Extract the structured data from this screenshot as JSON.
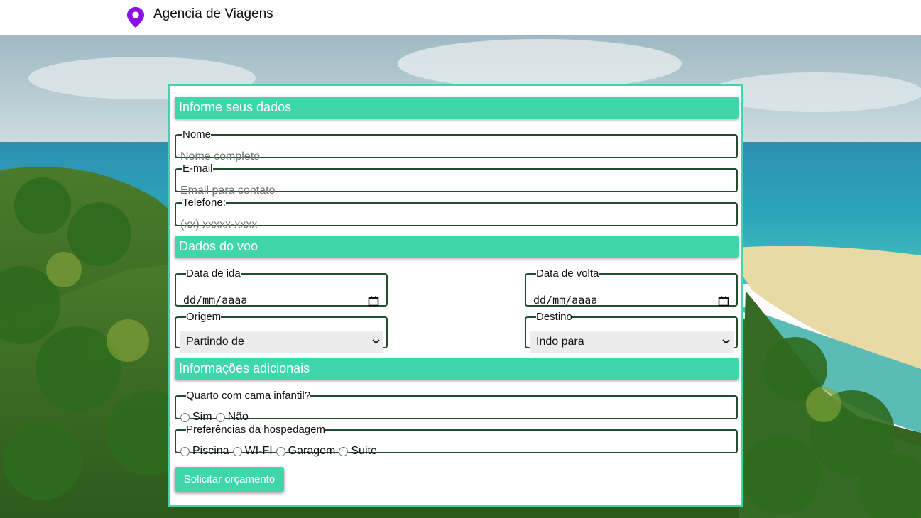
{
  "header": {
    "brand": "Agencia de Viagens",
    "logo_icon": "map-pin-icon",
    "logo_color": "#8b10e8"
  },
  "colors": {
    "accent": "#3fd6ac",
    "field_border": "#1f4f2f"
  },
  "sections": {
    "personal": "Informe seus dados",
    "flight": "Dados do voo",
    "extra": "Informações adicionais"
  },
  "fields": {
    "name": {
      "label": "Nome",
      "placeholder": "Nome completo"
    },
    "email": {
      "label": "E-mail",
      "placeholder": "Email para contato"
    },
    "phone": {
      "label": "Telefone:",
      "placeholder": "(xx) xxxxx-xxxx"
    },
    "departure_date": {
      "label": "Data de ida",
      "value": "dd/mm/aaaa"
    },
    "return_date": {
      "label": "Data de volta",
      "value": "dd/mm/aaaa"
    },
    "origin": {
      "label": "Origem",
      "selected": "Partindo de"
    },
    "destination": {
      "label": "Destino",
      "selected": "Indo para"
    },
    "child_bed": {
      "label": "Quarto com cama infantil?",
      "options": [
        "Sim",
        "Não"
      ]
    },
    "preferences": {
      "label": "Preferências da hospedagem",
      "options": [
        "Piscina",
        "WI-FI",
        "Garagem",
        "Suite"
      ]
    }
  },
  "submit_label": "Solicitar orçamento"
}
